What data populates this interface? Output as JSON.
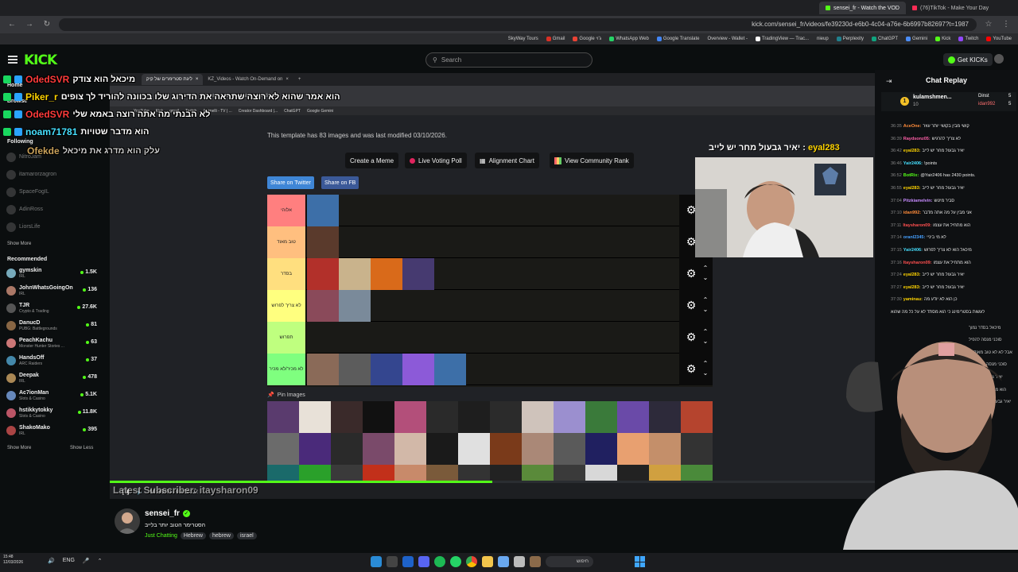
{
  "outer_browser": {
    "tabs": [
      {
        "label": "sensei_fr - Watch the VOD",
        "active": true
      },
      {
        "label": "(76)TikTok - Make Your Day",
        "active": false
      }
    ],
    "url": "kick.com/sensei_fr/videos/fe39230d-e6b0-4c04-a76e-6b6997b82697?t=1987",
    "bookmarks": [
      "YouTube",
      "Twitch",
      "Kick",
      "Gemini",
      "ChatGPT",
      "Perplexity",
      "nieup",
      "TradingView — Trac...",
      "Overview - Wallet -",
      "Google Translate",
      "WhatsApp Web",
      "Google ג'וי",
      "Gmail",
      "SkyWay Tours"
    ]
  },
  "kick_header": {
    "logo": "KICK",
    "search_placeholder": "Search",
    "get_kicks_label": "Get KICKs"
  },
  "overlay_chat": [
    {
      "user": "OdedSVR",
      "msg": "מיכאל הוא צודק",
      "color": "#ff3b3b",
      "text_color": "#ffffff"
    },
    {
      "user": "Piker_r",
      "msg": "הוא אמר שהוא לא רוצה שתראה את הדירוג שלו בכוונה להוריד לך צופים",
      "color": "#ffd400",
      "text_color": "#ffffff"
    },
    {
      "user": "OdedSVR",
      "msg": "לא הבנתי מה אתה רוצה באמא שלי",
      "color": "#ff3b3b",
      "text_color": "#ffffff"
    },
    {
      "user": "noam71781",
      "msg": "הוא מדבר שטויות",
      "color": "#46e0ff",
      "text_color": "#ffffff"
    },
    {
      "user": "Ofekde",
      "msg": "עלק הוא מדרג את מיכאל",
      "color": "#c9a15a",
      "text_color": "#c9c9c9"
    }
  ],
  "sidebar": {
    "home_label": "Home",
    "browse_label": "Browse",
    "following_title": "Following",
    "following": [
      {
        "name": "NitroJam"
      },
      {
        "name": "itamarorzagron"
      },
      {
        "name": "SpaceFogIL"
      },
      {
        "name": "AdinRoss"
      },
      {
        "name": "LiorsLife"
      }
    ],
    "show_more": "Show More",
    "recommended_title": "Recommended",
    "recommended": [
      {
        "name": "gymskin",
        "category": "IRL",
        "viewers": "1.5K",
        "color": "#7ab"
      },
      {
        "name": "JohnWhatsGoingOn",
        "category": "IRL",
        "viewers": "136",
        "color": "#a76"
      },
      {
        "name": "TJR",
        "category": "Crypto & Trading",
        "viewers": "27.6K",
        "color": "#555"
      },
      {
        "name": "DanucD",
        "category": "PUBG: Battlegrounds",
        "viewers": "81",
        "color": "#864"
      },
      {
        "name": "PeachKachu",
        "category": "Monster Hunter Stories ...",
        "viewers": "63",
        "color": "#c77"
      },
      {
        "name": "HandsOff",
        "category": "ARC Raiders",
        "viewers": "37",
        "color": "#48a"
      },
      {
        "name": "Deepak",
        "category": "IRL",
        "viewers": "478",
        "color": "#a85"
      },
      {
        "name": "Ac7ionMan",
        "category": "Slots & Casino",
        "viewers": "5.1K",
        "color": "#68b"
      },
      {
        "name": "hstikkytokky",
        "category": "Slots & Casino",
        "viewers": "11.8K",
        "color": "#b56"
      },
      {
        "name": "ShakoMako",
        "category": "IRL",
        "viewers": "395",
        "color": "#a44"
      }
    ],
    "show_more_2": "Show More",
    "show_less": "Show Less"
  },
  "inner_browser": {
    "tabs": [
      {
        "label": "ליגת סטרימרים של קיק",
        "active": true
      },
      {
        "label": "KZ_Videos - Watch On-Demand on",
        "active": false
      }
    ],
    "url": "tiermaker.com/create/----18969988",
    "bookmarks": [
      "YouTube",
      "Kick",
      "gmail",
      "Twitch",
      "Animelli - TV | ...",
      "Creator Dashboard |...",
      "ChatGPT",
      "Google Gemini"
    ]
  },
  "tiermaker": {
    "note": "This template has 83 images and was last modified 03/10/2026.",
    "buttons": {
      "create_meme": "Create a Meme",
      "live_voting": "Live Voting Poll",
      "alignment": "Alignment Chart",
      "community_rank": "View Community Rank"
    },
    "share_twitter": "Share on Twitter",
    "share_fb": "Share on FB",
    "tiers": [
      {
        "label": "אלוהי",
        "color": "#ff7f7f",
        "count": 1
      },
      {
        "label": "טוב מאוד",
        "color": "#ffbf7f",
        "count": 1
      },
      {
        "label": "בסדר",
        "color": "#ffdf7f",
        "count": 4
      },
      {
        "label": "לא צריך לפרוש",
        "color": "#ffff7f",
        "count": 2
      },
      {
        "label": "תפרוש",
        "color": "#bfff7f",
        "count": 0
      },
      {
        "label": "לא מכיר/לא מכיר",
        "color": "#7fff7f",
        "count": 5
      }
    ],
    "pin_label": "Pin Images"
  },
  "player": {
    "progress_fraction": 0.5,
    "time": "00:33:06 / 03:08:02",
    "last_sub_overlay": "Latest Subscriber: itaysharon09"
  },
  "overlay_caption": {
    "user": "eyal283",
    "msg": "יאיר גבעול מחר יש לייב :"
  },
  "chat": {
    "title": "Chat Replay",
    "top_gifters": [
      {
        "name": "kulamshmen...",
        "count": "10"
      },
      {
        "name": "Dinst",
        "count": "5"
      },
      {
        "name": "idan992",
        "count": "5"
      }
    ],
    "messages": [
      {
        "time": "36:35",
        "user": "AceOne",
        "msg": "קושי מבין בקושי יותר עוזר",
        "color": "#ff8c3b"
      },
      {
        "time": "36:39",
        "user": "Raydsonz05",
        "msg": "לא צריך להרגיש",
        "color": "#ff5fa8"
      },
      {
        "time": "36:42",
        "user": "eyal283",
        "msg": "יאיר גבעול מחר יש לייב",
        "color": "#ffd400"
      },
      {
        "time": "36:46",
        "user": "Yair2406",
        "msg": "!points",
        "color": "#46e0ff"
      },
      {
        "time": "36:52",
        "user": "BotRix",
        "msg": "@Yair2406 has 2430 points.",
        "color": "#53fc18"
      },
      {
        "time": "36:55",
        "user": "eyal283",
        "msg": "יאיר גבעול מחר יש לייב",
        "color": "#ffd400"
      },
      {
        "time": "37:04",
        "user": "Pitzkiamelvin",
        "msg": "סביר מיטש",
        "color": "#c78bff"
      },
      {
        "time": "37:10",
        "user": "idan992",
        "msg": "אני מבין על מה אתה מדבר",
        "color": "#ff8c3b"
      },
      {
        "time": "37:11",
        "user": "Itaysharon09",
        "msg": "הוא מתחיל את עצמו",
        "color": "#ff4f4f"
      },
      {
        "time": "37:14",
        "user": "oranl2345",
        "msg": "לא מי ביניי",
        "color": "#46a0ff"
      },
      {
        "time": "37:15",
        "user": "Yair2406",
        "msg": "מיכאל הוא לא צריך לפרוש",
        "color": "#46e0ff"
      },
      {
        "time": "37:16",
        "user": "Itaysharon09",
        "msg": "הוא מתחיל את עצמו",
        "color": "#ff4f4f"
      },
      {
        "time": "37:24",
        "user": "eyal283",
        "msg": "יאיר גבעול מחר יש לייב",
        "color": "#ffd400"
      },
      {
        "time": "37:27",
        "user": "eyal283",
        "msg": "יאיר גבעול מחר יש לייב",
        "color": "#ffd400"
      },
      {
        "time": "37:30",
        "user": "yaminau",
        "msg": "כן הוא לא יודע מה",
        "color": "#ffd400"
      },
      {
        "time": "",
        "user": "",
        "msg": "לעשות בסטרימינג כי הוא מסתד לא על כל מה שהוא",
        "color": "#ffffff"
      }
    ],
    "more_messages": [
      "מיכאל בסדר נמוך",
      "סוכני מנסה להפיל",
      "אבל לא לא טוב מאוד או",
      "סוכני מנסה להפיל או",
      "יאיר גבעול מחר יש",
      "הוא מתחיל את עצמו",
      "יאיר גבעול מחר יש לייב"
    ]
  },
  "streamer": {
    "name": "sensei_fr",
    "title": "הסטרימר הטוב יותר בלייב",
    "category": "Just Chatting",
    "tags": [
      "Hebrew",
      "hebrew",
      "israel"
    ]
  },
  "taskbar": {
    "time": "15:48",
    "date": "12/03/2026",
    "lang": "ENG",
    "search_label": "חיפוש"
  }
}
